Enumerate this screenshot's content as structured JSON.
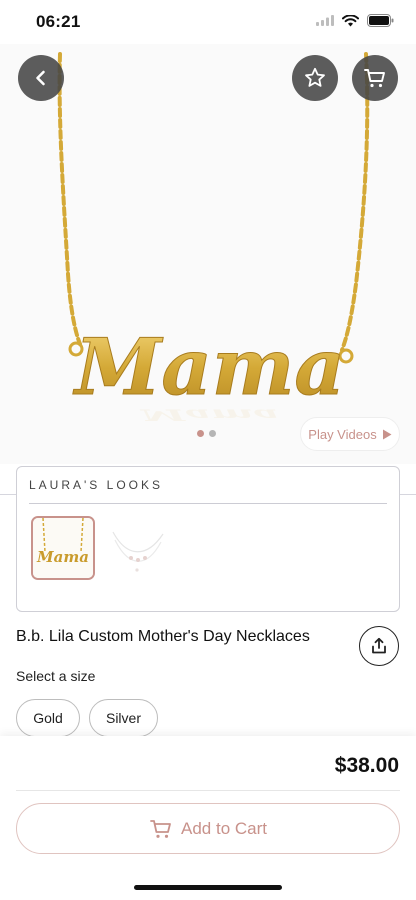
{
  "status_bar": {
    "time": "06:21",
    "icons": [
      "signal-icon",
      "wifi-icon",
      "battery-icon"
    ]
  },
  "header": {
    "back_icon": "chevron-left-icon",
    "favorite_icon": "star-icon",
    "cart_icon": "cart-icon"
  },
  "gallery": {
    "product_word": "Mama",
    "dots_count": 2,
    "active_dot": 0,
    "play_videos_label": "Play Videos"
  },
  "looks": {
    "title": "LAURA'S LOOKS",
    "thumbnail_1_text": "Mama",
    "selected_index": 0
  },
  "product": {
    "title": "B.b. Lila Custom Mother's Day Necklaces",
    "share_icon": "share-icon"
  },
  "size": {
    "label": "Select a size",
    "options": [
      "Gold",
      "Silver"
    ]
  },
  "bottom": {
    "price": "$38.00",
    "add_to_cart_label": "Add to Cart"
  },
  "colors": {
    "accent": "#c8928b",
    "gold": "#d4a937",
    "overlay_button": "#464646"
  }
}
